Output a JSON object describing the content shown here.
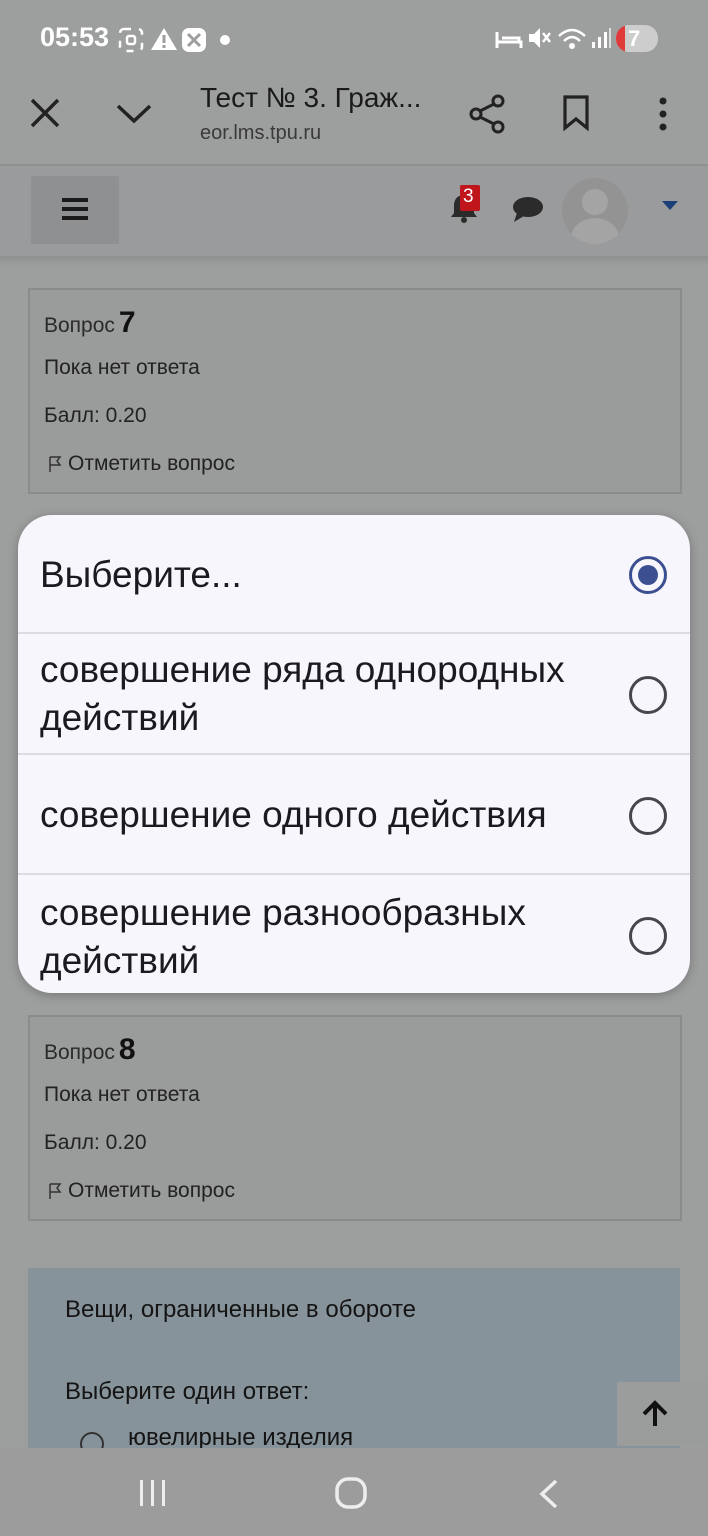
{
  "status_bar": {
    "time": "05:53",
    "battery_level": "7"
  },
  "browser": {
    "title": "Тест № 3. Граж...",
    "url": "eor.lms.tpu.ru"
  },
  "navbar": {
    "notification_count": "3"
  },
  "questions": [
    {
      "label": "Вопрос",
      "number": "7",
      "state": "Пока нет ответа",
      "mark": "Балл: 0.20",
      "flag": "Отметить вопрос"
    },
    {
      "label": "Вопрос",
      "number": "8",
      "state": "Пока нет ответа",
      "mark": "Балл: 0.20",
      "flag": "Отметить вопрос"
    }
  ],
  "dropdown": {
    "options": [
      {
        "label": "Выберите...",
        "selected": true
      },
      {
        "label": "совершение ряда однородных действий",
        "selected": false
      },
      {
        "label": "совершение одного действия",
        "selected": false
      },
      {
        "label": "совершение разнообразных действий",
        "selected": false
      }
    ]
  },
  "question9": {
    "text": "Вещи, ограниченные в обороте",
    "prompt": "Выберите один ответ:",
    "first_option": "ювелирные изделия"
  },
  "colors": {
    "accent": "#3c4f90",
    "badge": "#c0151b",
    "dialog_bg": "#f7f6fd",
    "info_bg": "#87939a"
  }
}
